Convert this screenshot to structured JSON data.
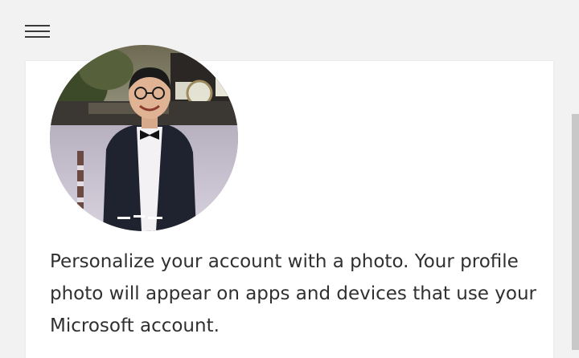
{
  "header": {
    "menu_icon": "hamburger-menu-icon"
  },
  "profile": {
    "photo": "profile-photo",
    "description": "Personalize your account with a photo. Your profile photo will appear on apps and devices that use your Microsoft account."
  },
  "colors": {
    "page_background": "#f2f2f2",
    "card_background": "#ffffff",
    "text": "#303030",
    "scrollbar": "#c8c8c8"
  }
}
